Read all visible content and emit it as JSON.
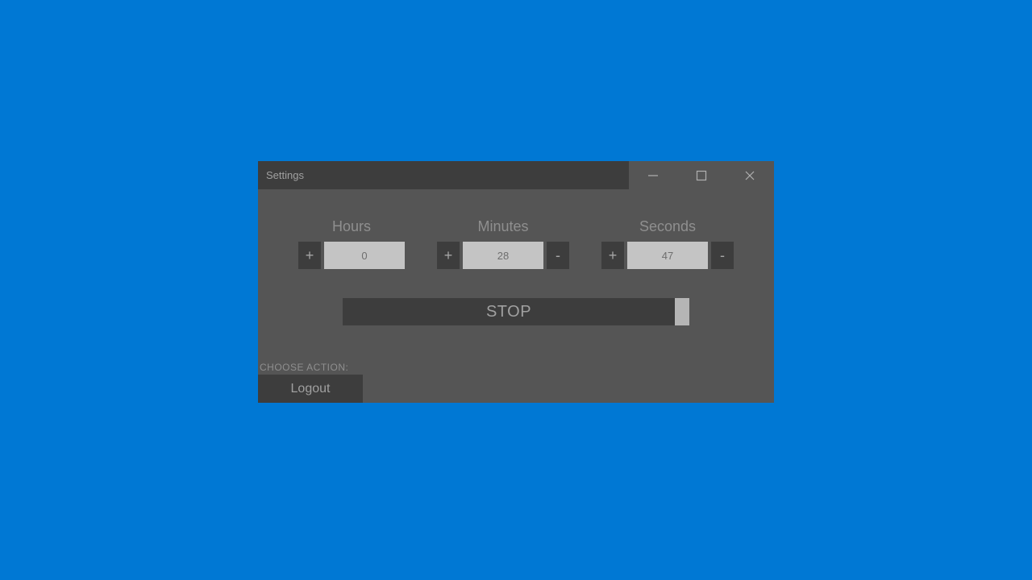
{
  "titlebar": {
    "settings_label": "Settings"
  },
  "timer": {
    "hours": {
      "label": "Hours",
      "value": "0",
      "plus": "+",
      "minus": "-"
    },
    "minutes": {
      "label": "Minutes",
      "value": "28",
      "plus": "+",
      "minus": "-"
    },
    "seconds": {
      "label": "Seconds",
      "value": "47",
      "plus": "+",
      "minus": "-"
    }
  },
  "main_button": {
    "label": "STOP"
  },
  "footer": {
    "choose_label": "CHOOSE ACTION:",
    "selected_action": "Logout"
  }
}
